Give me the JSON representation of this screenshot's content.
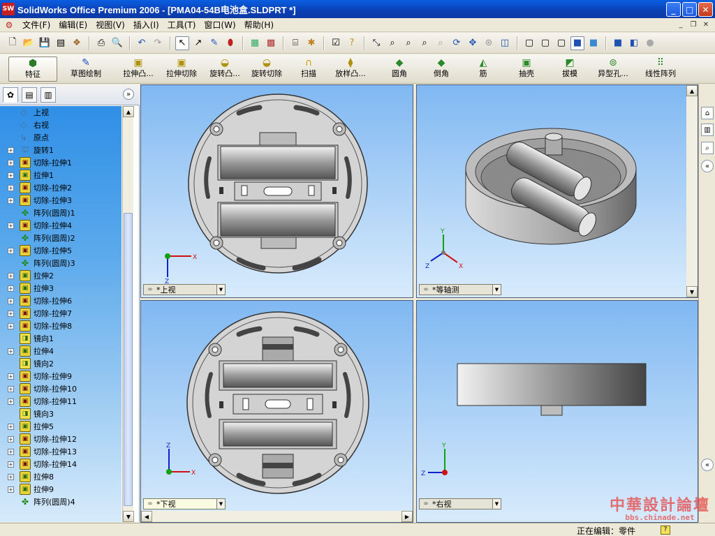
{
  "window": {
    "title": "SolidWorks Office Premium 2006 - [PMA04-54B电池盒.SLDPRT *]",
    "app_logo": "SW",
    "minimize": "_",
    "maximize": "□",
    "close": "✕"
  },
  "menu": {
    "items": [
      "文件(F)",
      "编辑(E)",
      "视图(V)",
      "插入(I)",
      "工具(T)",
      "窗口(W)",
      "帮助(H)"
    ]
  },
  "feature_toolbar": {
    "tools": [
      "特征",
      "草图绘制",
      "拉伸凸...",
      "拉伸切除",
      "旋转凸...",
      "旋转切除",
      "扫描",
      "放样凸...",
      "圆角",
      "倒角",
      "筋",
      "抽壳",
      "拔模",
      "异型孔...",
      "线性阵列"
    ]
  },
  "feature_tree": {
    "items": [
      {
        "label": "上视",
        "icon": "plane-icon",
        "expandable": false
      },
      {
        "label": "右视",
        "icon": "plane-icon",
        "expandable": false
      },
      {
        "label": "原点",
        "icon": "origin-icon",
        "expandable": false
      },
      {
        "label": "旋转1",
        "icon": "revolve-icon",
        "expandable": true
      },
      {
        "label": "切除-拉伸1",
        "icon": "cut-extrude-icon",
        "expandable": true
      },
      {
        "label": "拉伸1",
        "icon": "boss-extrude-icon",
        "expandable": true
      },
      {
        "label": "切除-拉伸2",
        "icon": "cut-extrude-icon",
        "expandable": true
      },
      {
        "label": "切除-拉伸3",
        "icon": "cut-extrude-icon",
        "expandable": true
      },
      {
        "label": "阵列(圆周)1",
        "icon": "circular-pattern-icon",
        "expandable": false
      },
      {
        "label": "切除-拉伸4",
        "icon": "cut-extrude-icon",
        "expandable": true
      },
      {
        "label": "阵列(圆周)2",
        "icon": "circular-pattern-icon",
        "expandable": false
      },
      {
        "label": "切除-拉伸5",
        "icon": "cut-extrude-icon",
        "expandable": true
      },
      {
        "label": "阵列(圆周)3",
        "icon": "circular-pattern-icon",
        "expandable": false
      },
      {
        "label": "拉伸2",
        "icon": "boss-extrude-icon",
        "expandable": true
      },
      {
        "label": "拉伸3",
        "icon": "boss-extrude-icon",
        "expandable": true
      },
      {
        "label": "切除-拉伸6",
        "icon": "cut-extrude-icon",
        "expandable": true
      },
      {
        "label": "切除-拉伸7",
        "icon": "cut-extrude-icon",
        "expandable": true
      },
      {
        "label": "切除-拉伸8",
        "icon": "cut-extrude-icon",
        "expandable": true
      },
      {
        "label": "镜向1",
        "icon": "mirror-icon",
        "expandable": false
      },
      {
        "label": "拉伸4",
        "icon": "boss-extrude-icon",
        "expandable": true
      },
      {
        "label": "镜向2",
        "icon": "mirror-icon",
        "expandable": false
      },
      {
        "label": "切除-拉伸9",
        "icon": "cut-extrude-icon",
        "expandable": true
      },
      {
        "label": "切除-拉伸10",
        "icon": "cut-extrude-icon",
        "expandable": true
      },
      {
        "label": "切除-拉伸11",
        "icon": "cut-extrude-icon",
        "expandable": true
      },
      {
        "label": "镜向3",
        "icon": "mirror-icon",
        "expandable": false
      },
      {
        "label": "拉伸5",
        "icon": "boss-extrude-icon",
        "expandable": true
      },
      {
        "label": "切除-拉伸12",
        "icon": "cut-extrude-icon",
        "expandable": true
      },
      {
        "label": "切除-拉伸13",
        "icon": "cut-extrude-icon",
        "expandable": true
      },
      {
        "label": "切除-拉伸14",
        "icon": "cut-extrude-icon",
        "expandable": true
      },
      {
        "label": "拉伸8",
        "icon": "boss-extrude-icon",
        "expandable": true
      },
      {
        "label": "拉伸9",
        "icon": "boss-extrude-icon",
        "expandable": true
      },
      {
        "label": "阵列(圆周)4",
        "icon": "circular-pattern-icon",
        "expandable": false
      }
    ]
  },
  "viewports": {
    "top": {
      "label": "*上视",
      "lock": "∞"
    },
    "iso": {
      "label": "*等轴测",
      "lock": "∞"
    },
    "bottom": {
      "label": "*下视",
      "lock": "∞"
    },
    "right": {
      "label": "*右视",
      "lock": "∞"
    }
  },
  "axes": {
    "x": "X",
    "y": "Y",
    "z": "Z"
  },
  "status": {
    "editing": "正在编辑：零件",
    "help": "?"
  },
  "watermark": {
    "cn": "中華設計論壇",
    "url": "bbs.chinade.net"
  },
  "colors": {
    "titlebar": "#0a3fb4",
    "viewport_top": "#80b8f2",
    "viewport_bottom": "#d8ebfc",
    "axis_x": "#d01010",
    "axis_y": "#10a010",
    "axis_z": "#1020d0"
  }
}
